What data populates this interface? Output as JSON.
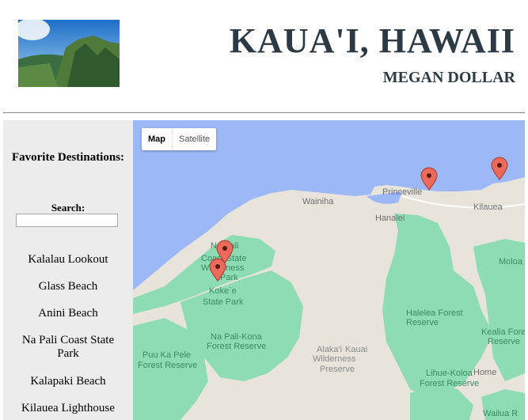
{
  "header": {
    "title": "KAUA'I, HAWAII",
    "subtitle": "MEGAN DOLLAR"
  },
  "sidebar": {
    "heading": "Favorite Destinations:",
    "search_label": "Search:",
    "search_value": "",
    "destinations": [
      "Kalalau Lookout",
      "Glass Beach",
      "Anini Beach",
      "Na Pali Coast State Park",
      "Kalapaki Beach",
      "Kilauea Lighthouse"
    ]
  },
  "map": {
    "type_buttons": [
      "Map",
      "Satellite"
    ],
    "selected_type": "Map",
    "labels": {
      "princeville": "Princeville",
      "kilauea": "Kilauea",
      "wainiha": "Wainiha",
      "hanalei": "Hanalei",
      "napali_1": "Na Pali",
      "napali_2": "Coast State",
      "napali_3": "Wilderness",
      "napali_4": "Park",
      "kokee_1": "Koke`e",
      "kokee_2": "State Park",
      "napalikona_1": "Na Pali-Kona",
      "napalikona_2": "Forest Reserve",
      "halelea_1": "Halelea Forest",
      "halelea_2": "Reserve",
      "alakai_1": "Alaka'i",
      "alakai_2": "Wilderness",
      "alakai_3": "Preserve",
      "kauai": "Kauai",
      "puukapele_1": "Puu Ka Pele",
      "puukapele_2": "Forest Reserve",
      "lihue_1": "Lihue-Koloa",
      "lihue_2": "Forest Reserve",
      "kealia_1": "Kealia Forest",
      "kealia_2": "Reserve",
      "moloaa": "Moloa",
      "homestead": "Home",
      "wailua": "Wailua R"
    },
    "colors": {
      "ocean": "#9db8f6",
      "land": "#e8e4dc",
      "park": "#8ddcb4",
      "marker": "#ea6a5c"
    }
  }
}
